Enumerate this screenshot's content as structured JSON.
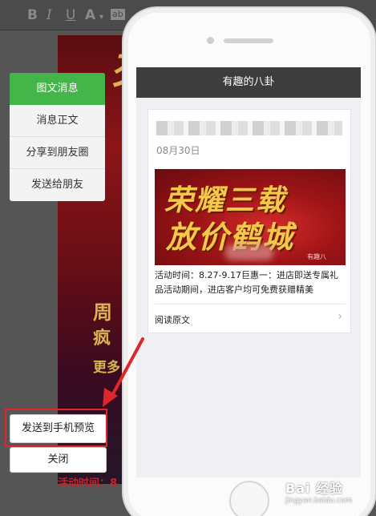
{
  "toolbar": {
    "icons": [
      "bold-icon",
      "italic-icon",
      "underline-icon",
      "font-color-icon",
      "background-color-icon"
    ],
    "bold": "B",
    "italic": "I",
    "underline": "U",
    "font_color": "A",
    "background_color": "ab"
  },
  "menu": {
    "items": [
      {
        "label": "图文消息",
        "active": true
      },
      {
        "label": "消息正文",
        "active": false
      },
      {
        "label": "分享到朋友圈",
        "active": false
      },
      {
        "label": "发送给朋友",
        "active": false
      }
    ]
  },
  "actions": {
    "preview_label": "发送到手机预览",
    "close_label": "关闭"
  },
  "phone": {
    "header_title": "有趣的八卦",
    "article": {
      "date": "08月30日",
      "banner_line1": "荣耀三载",
      "banner_line2": "放价鹤城",
      "banner_mark": "有趣八",
      "description": "活动时间：8.27-9.17巨惠一：进店即送专属礼品活动期间，进店客户均可免费获赠精美",
      "read_more": "阅读原文"
    }
  },
  "editor_background": {
    "big_chars": [
      "周",
      "疯",
      "更多",
      "活动时间：8"
    ]
  },
  "watermark": {
    "brand": "Bai 经验",
    "url": "jingyan.baidu.com"
  },
  "colors": {
    "accent_green": "#44b549",
    "highlight_red": "#e0252b",
    "header_dark": "#3d3d3d"
  }
}
